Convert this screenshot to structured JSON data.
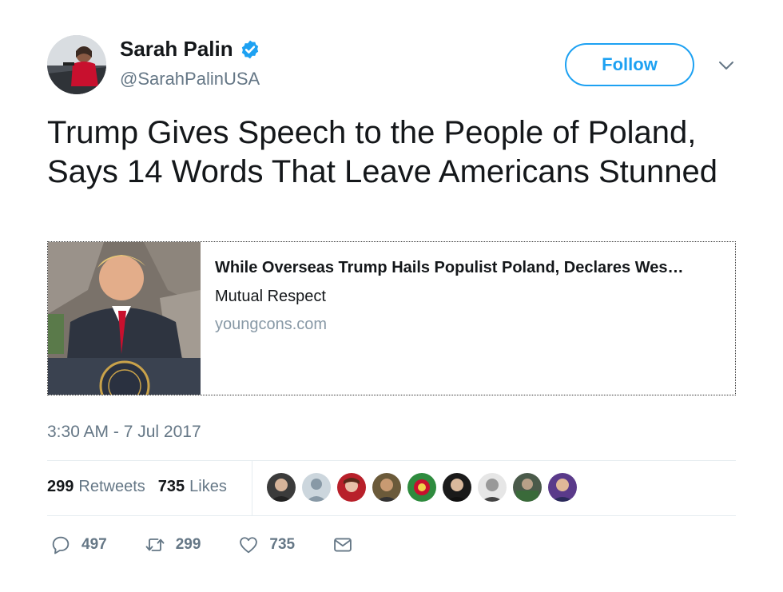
{
  "user": {
    "name": "Sarah Palin",
    "handle": "@SarahPalinUSA",
    "verified": true
  },
  "follow_label": "Follow",
  "tweet_text": "Trump Gives Speech to the People of Poland, Says 14 Words That Leave Americans Stunned",
  "card": {
    "title": "While Overseas Trump Hails Populist Poland, Declares Wes…",
    "description": "Mutual Respect",
    "domain": "youngcons.com"
  },
  "timestamp": "3:30 AM - 7 Jul 2017",
  "stats": {
    "retweets_count": "299",
    "retweets_label": "Retweets",
    "likes_count": "735",
    "likes_label": "Likes"
  },
  "actions": {
    "reply_count": "497",
    "retweet_count": "299",
    "like_count": "735"
  },
  "colors": {
    "accent": "#1da1f2",
    "secondary_text": "#657786"
  }
}
